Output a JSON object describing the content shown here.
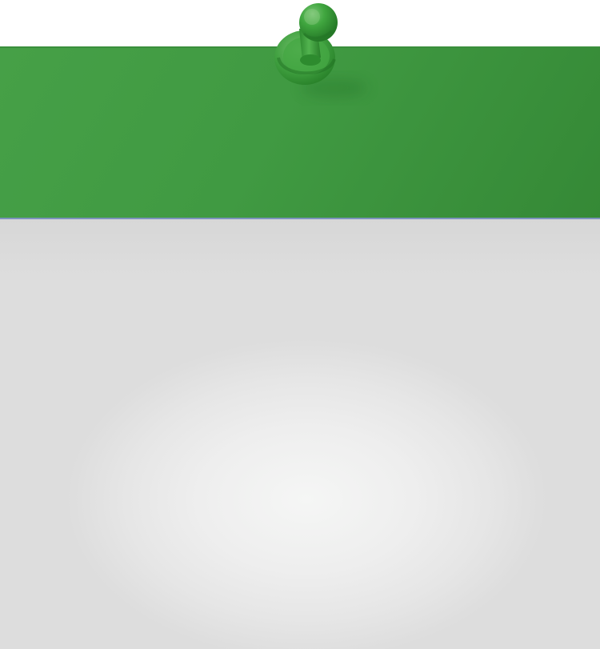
{
  "note": {
    "header_color": "#409a42",
    "body_color": "#e6e6e6",
    "pin_color": "#3f9d3f",
    "pin_icon": "pushpin-icon"
  }
}
